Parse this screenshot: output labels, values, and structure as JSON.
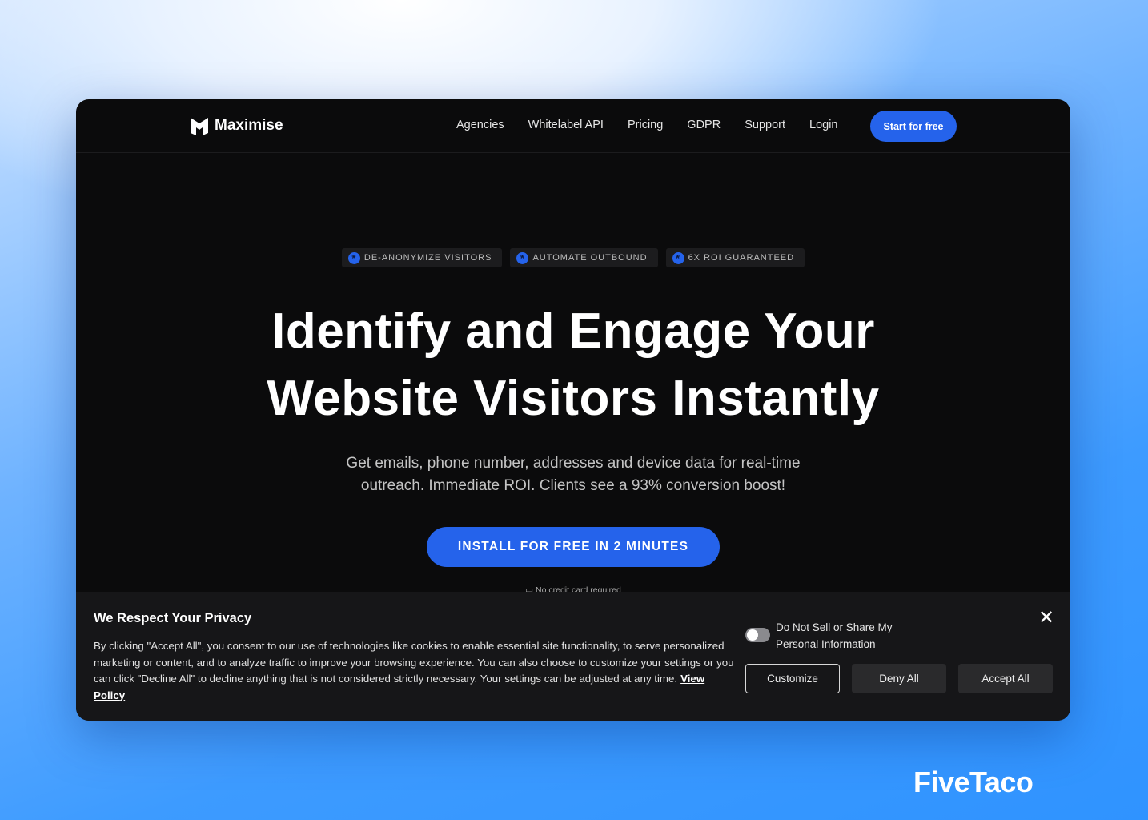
{
  "nav": {
    "brand": "Maximise",
    "links": [
      "Agencies",
      "Whitelabel API",
      "Pricing",
      "GDPR",
      "Support",
      "Login"
    ],
    "cta": "Start for free"
  },
  "hero": {
    "badges": [
      "DE-ANONYMIZE VISITORS",
      "AUTOMATE OUTBOUND",
      "6X ROI GUARANTEED"
    ],
    "title_line1": "Identify and Engage Your",
    "title_line2": "Website Visitors Instantly",
    "subtitle_line1": "Get emails, phone number, addresses and device data for real-time",
    "subtitle_line2": "outreach. Immediate ROI. Clients see a 93% conversion boost!",
    "cta": "INSTALL FOR FREE IN 2 MINUTES",
    "note": "No credit card required"
  },
  "cookie": {
    "title": "We Respect Your Privacy",
    "body": "By clicking \"Accept All\", you consent to our use of technologies like cookies to enable essential site functionality, to serve personalized marketing or content, and to analyze traffic to improve your browsing experience. You can also choose to customize your settings or you can click \"Decline All\" to decline anything that is not considered strictly necessary. Your settings can be adjusted at any time.",
    "policy_link": "View Policy",
    "toggle_label_line1": "Do Not Sell or Share My",
    "toggle_label_line2": "Personal Information",
    "toggle_on": false,
    "customize": "Customize",
    "deny": "Deny All",
    "accept": "Accept All"
  },
  "watermark": "FiveTaco",
  "colors": {
    "accent": "#2563eb",
    "background": "#0b0b0c",
    "banner": "#161618"
  }
}
